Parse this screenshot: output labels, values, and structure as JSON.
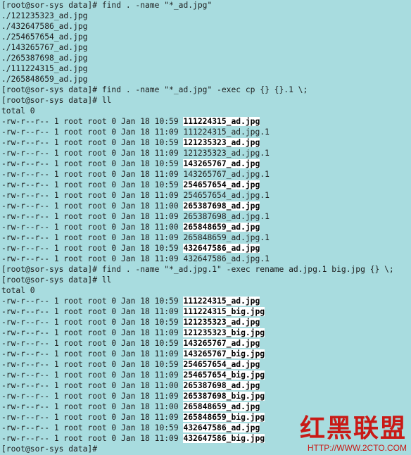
{
  "terminal": {
    "lines": [
      {
        "text": "[root@sor-sys data]# find . -name \"*_ad.jpg\""
      },
      {
        "text": "./121235323_ad.jpg"
      },
      {
        "text": "./432647586_ad.jpg"
      },
      {
        "text": "./254657654_ad.jpg"
      },
      {
        "text": "./143265767_ad.jpg"
      },
      {
        "text": "./265387698_ad.jpg"
      },
      {
        "text": "./111224315_ad.jpg"
      },
      {
        "text": "./265848659_ad.jpg"
      },
      {
        "text": "[root@sor-sys data]# find . -name \"*_ad.jpg\" -exec cp {} {}.1 \\;"
      },
      {
        "text": "[root@sor-sys data]# ll"
      },
      {
        "text": "total 0"
      },
      {
        "text": "-rw-r--r-- 1 root root 0 Jan 18 10:59 ",
        "file": "111224315_ad.jpg",
        "hl": true
      },
      {
        "text": "-rw-r--r-- 1 root root 0 Jan 18 11:09 111224315_ad.jpg.1"
      },
      {
        "text": "-rw-r--r-- 1 root root 0 Jan 18 10:59 ",
        "file": "121235323_ad.jpg",
        "hl": true
      },
      {
        "text": "-rw-r--r-- 1 root root 0 Jan 18 11:09 121235323_ad.jpg.1"
      },
      {
        "text": "-rw-r--r-- 1 root root 0 Jan 18 10:59 ",
        "file": "143265767_ad.jpg",
        "hl": true
      },
      {
        "text": "-rw-r--r-- 1 root root 0 Jan 18 11:09 143265767_ad.jpg.1"
      },
      {
        "text": "-rw-r--r-- 1 root root 0 Jan 18 10:59 ",
        "file": "254657654_ad.jpg",
        "hl": true
      },
      {
        "text": "-rw-r--r-- 1 root root 0 Jan 18 11:09 254657654_ad.jpg.1"
      },
      {
        "text": "-rw-r--r-- 1 root root 0 Jan 18 11:00 ",
        "file": "265387698_ad.jpg",
        "hl": true
      },
      {
        "text": "-rw-r--r-- 1 root root 0 Jan 18 11:09 265387698_ad.jpg.1"
      },
      {
        "text": "-rw-r--r-- 1 root root 0 Jan 18 11:00 ",
        "file": "265848659_ad.jpg",
        "hl": true
      },
      {
        "text": "-rw-r--r-- 1 root root 0 Jan 18 11:09 265848659_ad.jpg.1"
      },
      {
        "text": "-rw-r--r-- 1 root root 0 Jan 18 10:59 ",
        "file": "432647586_ad.jpg",
        "hl": true
      },
      {
        "text": "-rw-r--r-- 1 root root 0 Jan 18 11:09 432647586_ad.jpg.1"
      },
      {
        "text": "[root@sor-sys data]# find . -name \"*_ad.jpg.1\" -exec rename ad.jpg.1 big.jpg {} \\;"
      },
      {
        "text": "[root@sor-sys data]# ll"
      },
      {
        "text": "total 0"
      },
      {
        "text": "-rw-r--r-- 1 root root 0 Jan 18 10:59 ",
        "file": "111224315_ad.jpg",
        "hl": true
      },
      {
        "text": "-rw-r--r-- 1 root root 0 Jan 18 11:09 ",
        "file": "111224315_big.jpg",
        "hl": true
      },
      {
        "text": "-rw-r--r-- 1 root root 0 Jan 18 10:59 ",
        "file": "121235323_ad.jpg",
        "hl": true
      },
      {
        "text": "-rw-r--r-- 1 root root 0 Jan 18 11:09 ",
        "file": "121235323_big.jpg",
        "hl": true
      },
      {
        "text": "-rw-r--r-- 1 root root 0 Jan 18 10:59 ",
        "file": "143265767_ad.jpg",
        "hl": true
      },
      {
        "text": "-rw-r--r-- 1 root root 0 Jan 18 11:09 ",
        "file": "143265767_big.jpg",
        "hl": true
      },
      {
        "text": "-rw-r--r-- 1 root root 0 Jan 18 10:59 ",
        "file": "254657654_ad.jpg",
        "hl": true
      },
      {
        "text": "-rw-r--r-- 1 root root 0 Jan 18 11:09 ",
        "file": "254657654_big.jpg",
        "hl": true
      },
      {
        "text": "-rw-r--r-- 1 root root 0 Jan 18 11:00 ",
        "file": "265387698_ad.jpg",
        "hl": true
      },
      {
        "text": "-rw-r--r-- 1 root root 0 Jan 18 11:09 ",
        "file": "265387698_big.jpg",
        "hl": true
      },
      {
        "text": "-rw-r--r-- 1 root root 0 Jan 18 11:00 ",
        "file": "265848659_ad.jpg",
        "hl": true
      },
      {
        "text": "-rw-r--r-- 1 root root 0 Jan 18 11:09 ",
        "file": "265848659_big.jpg",
        "hl": true
      },
      {
        "text": "-rw-r--r-- 1 root root 0 Jan 18 10:59 ",
        "file": "432647586_ad.jpg",
        "hl": true
      },
      {
        "text": "-rw-r--r-- 1 root root 0 Jan 18 11:09 ",
        "file": "432647586_big.jpg",
        "hl": true
      },
      {
        "text": "[root@sor-sys data]#"
      }
    ]
  },
  "watermark": {
    "cjk": "红黑联盟",
    "url": "HTTP://WWW.2CTO.COM"
  },
  "colors": {
    "background": "#a8dcdf",
    "text": "#1c1c1c",
    "highlight_bg": "#ffffff",
    "watermark": "#c91a16"
  }
}
